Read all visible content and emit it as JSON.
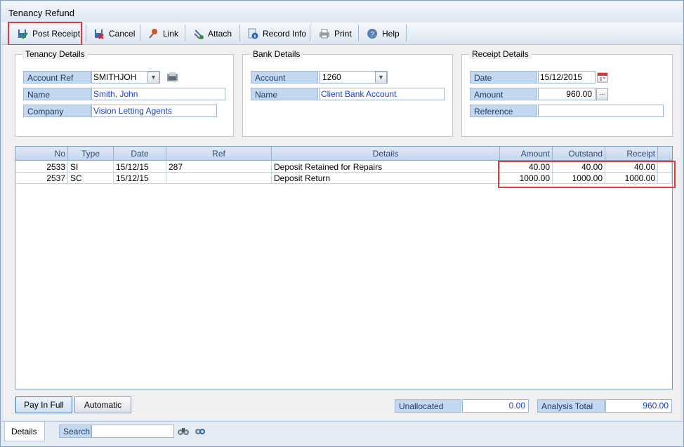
{
  "window": {
    "title": "Tenancy Refund"
  },
  "toolbar": {
    "post_receipt": "Post Receipt",
    "cancel": "Cancel",
    "link": "Link",
    "attach": "Attach",
    "record_info": "Record Info",
    "print": "Print",
    "help": "Help"
  },
  "tenancy": {
    "title": "Tenancy Details",
    "account_ref_label": "Account Ref",
    "account_ref_value": "SMITHJOH",
    "name_label": "Name",
    "name_value": "Smith, John",
    "company_label": "Company",
    "company_value": "Vision Letting Agents"
  },
  "bank": {
    "title": "Bank Details",
    "account_label": "Account",
    "account_value": "1260",
    "name_label": "Name",
    "name_value": "Client Bank Account"
  },
  "receipt": {
    "title": "Receipt Details",
    "date_label": "Date",
    "date_value": "15/12/2015",
    "amount_label": "Amount",
    "amount_value": "960.00",
    "reference_label": "Reference",
    "reference_value": ""
  },
  "grid": {
    "headers": {
      "no": "No",
      "type": "Type",
      "date": "Date",
      "ref": "Ref",
      "details": "Details",
      "amount": "Amount",
      "outstand": "Outstand",
      "receipt": "Receipt"
    },
    "rows": [
      {
        "no": "2533",
        "type": "SI",
        "date": "15/12/15",
        "ref": "287",
        "details": "Deposit Retained for Repairs",
        "amount": "40.00",
        "outstand": "40.00",
        "receipt": "40.00"
      },
      {
        "no": "2537",
        "type": "SC",
        "date": "15/12/15",
        "ref": "",
        "details": "Deposit Return",
        "amount": "1000.00",
        "outstand": "1000.00",
        "receipt": "1000.00"
      }
    ]
  },
  "footer": {
    "pay_in_full": "Pay In Full",
    "automatic": "Automatic",
    "unallocated_label": "Unallocated",
    "unallocated_value": "0.00",
    "analysis_total_label": "Analysis Total",
    "analysis_total_value": "960.00"
  },
  "status": {
    "details_tab": "Details",
    "search_label": "Search",
    "search_value": ""
  },
  "colors": {
    "highlight": "#e03c3c",
    "label_bg": "#c4d9f1",
    "value_blue": "#1c3ccc"
  }
}
